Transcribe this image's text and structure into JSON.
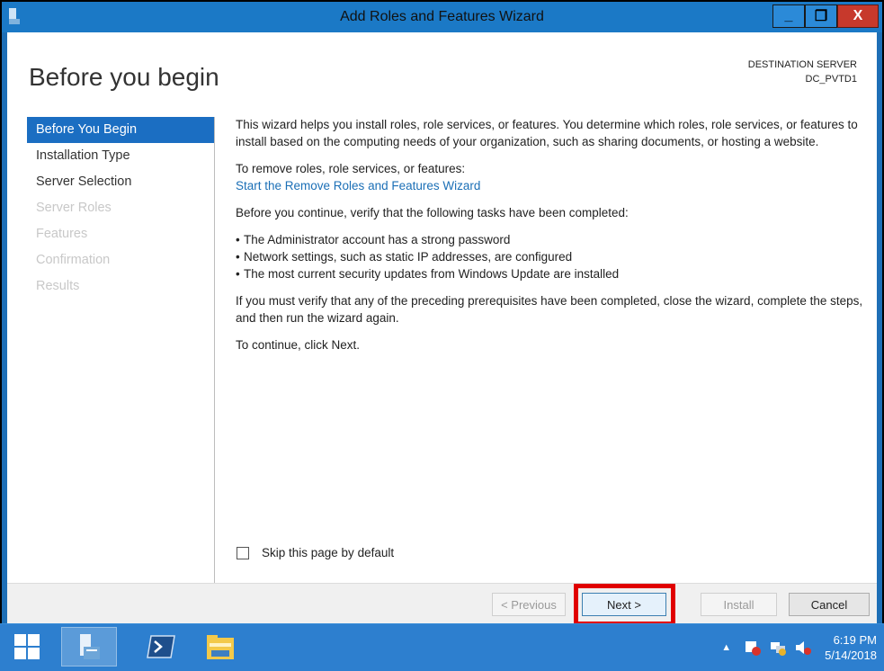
{
  "window": {
    "title": "Add Roles and Features Wizard",
    "minimize_label": "_",
    "restore_label": "❐",
    "close_label": "X"
  },
  "header": {
    "page_title": "Before you begin",
    "destination_label": "DESTINATION SERVER",
    "destination_value": "DC_PVTD1"
  },
  "nav": {
    "items": [
      {
        "label": "Before You Begin",
        "state": "active"
      },
      {
        "label": "Installation Type",
        "state": "enabled"
      },
      {
        "label": "Server Selection",
        "state": "enabled"
      },
      {
        "label": "Server Roles",
        "state": "disabled"
      },
      {
        "label": "Features",
        "state": "disabled"
      },
      {
        "label": "Confirmation",
        "state": "disabled"
      },
      {
        "label": "Results",
        "state": "disabled"
      }
    ]
  },
  "main": {
    "intro": "This wizard helps you install roles, role services, or features. You determine which roles, role services, or features to install based on the computing needs of your organization, such as sharing documents, or hosting a website.",
    "remove_text": "To remove roles, role services, or features:",
    "remove_link": "Start the Remove Roles and Features Wizard",
    "verify_text": "Before you continue, verify that the following tasks have been completed:",
    "bullets": [
      "The Administrator account has a strong password",
      "Network settings, such as static IP addresses, are configured",
      "The most current security updates from Windows Update are installed"
    ],
    "prereq_text": "If you must verify that any of the preceding prerequisites have been completed, close the wizard, complete the steps, and then run the wizard again.",
    "continue_text": "To continue, click Next.",
    "skip_label": "Skip this page by default",
    "skip_checked": false
  },
  "footer": {
    "previous_label": "< Previous",
    "next_label": "Next >",
    "install_label": "Install",
    "cancel_label": "Cancel"
  },
  "taskbar": {
    "time": "6:19 PM",
    "date": "5/14/2018"
  },
  "colors": {
    "accent": "#1b6ec2",
    "highlight": "#e00000",
    "taskbar": "#2d7fcf"
  }
}
